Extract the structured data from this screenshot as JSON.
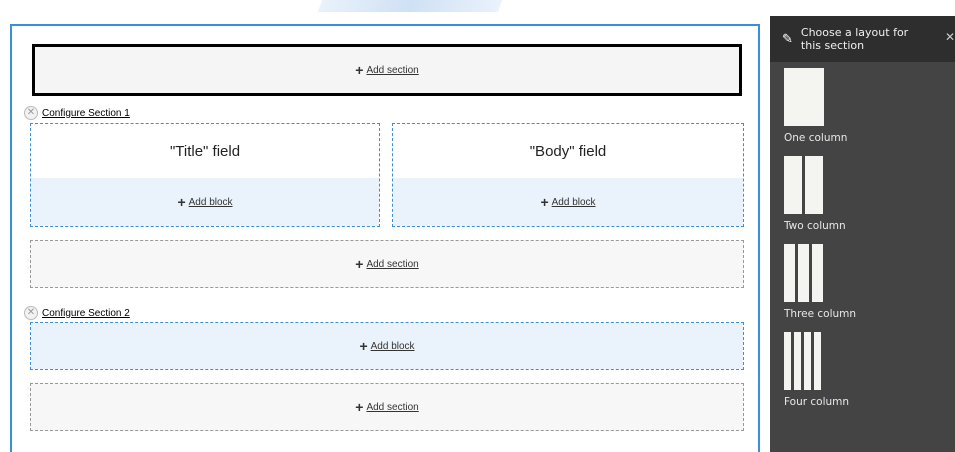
{
  "builder": {
    "add_section_label": "Add section",
    "add_block_label": "Add block",
    "sections": [
      {
        "configure_label": "Configure Section 1",
        "regions": [
          {
            "field": "\"Title\" field"
          },
          {
            "field": "\"Body\" field"
          }
        ]
      },
      {
        "configure_label": "Configure Section 2"
      }
    ]
  },
  "sidebar": {
    "title": "Choose a layout for this section",
    "close_icon": "close-icon",
    "pencil_icon": "pencil-icon",
    "layouts": [
      {
        "label": "One column",
        "columns": 1
      },
      {
        "label": "Two column",
        "columns": 2
      },
      {
        "label": "Three column",
        "columns": 3
      },
      {
        "label": "Four column",
        "columns": 4
      }
    ]
  },
  "colors": {
    "accent": "#3a8fd6",
    "sidebar_bg": "#444444",
    "sidebar_header_bg": "#2e2e2e",
    "block_bg": "#eaf3fb"
  }
}
